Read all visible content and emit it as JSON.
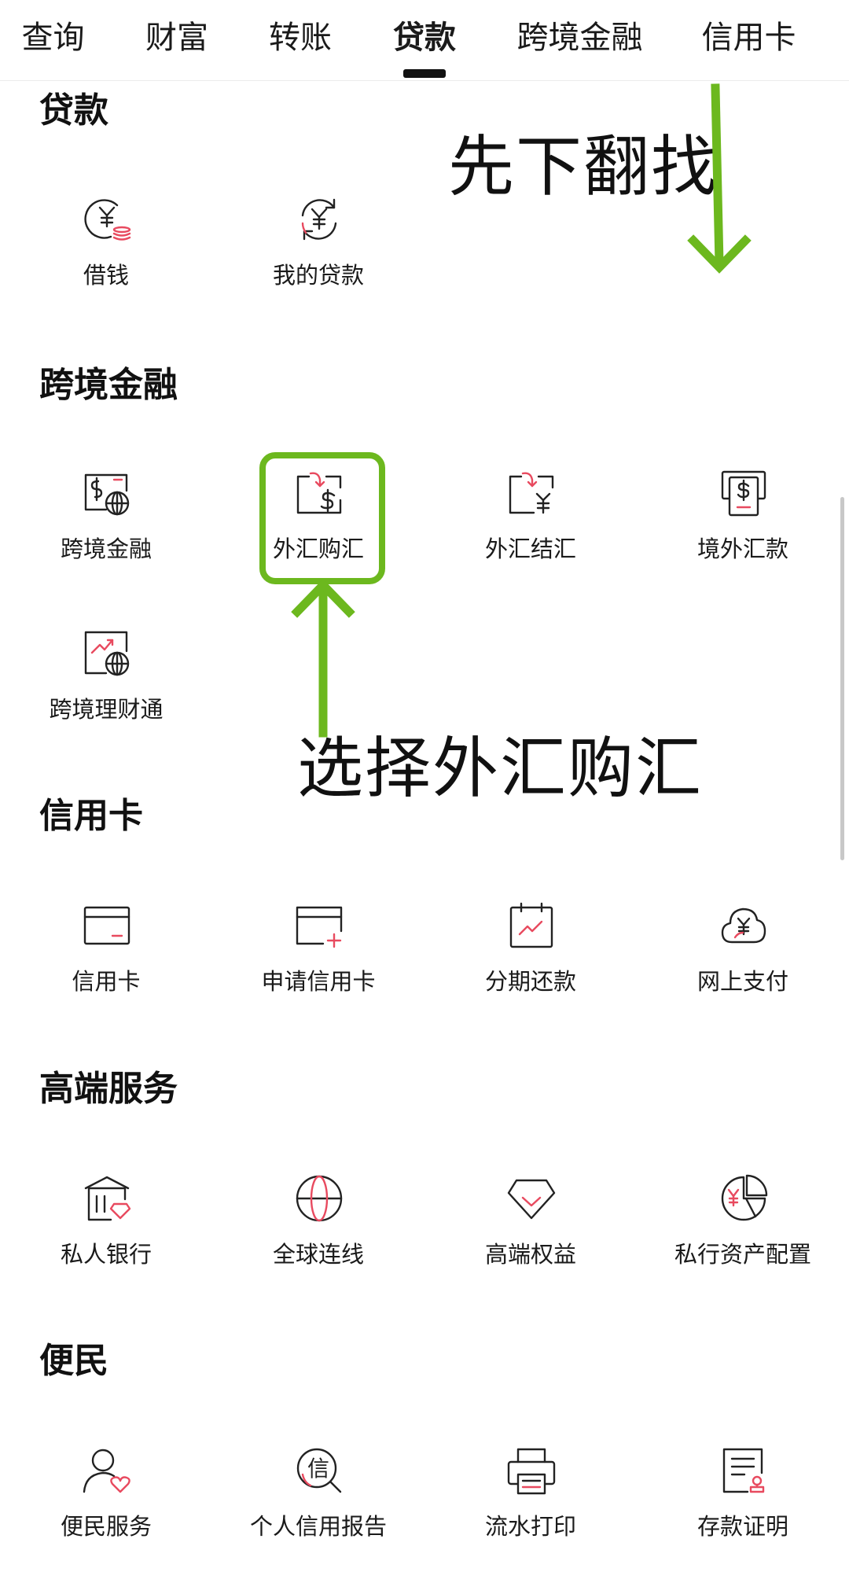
{
  "tabs": [
    {
      "label": "查询",
      "active": false
    },
    {
      "label": "财富",
      "active": false
    },
    {
      "label": "转账",
      "active": false
    },
    {
      "label": "贷款",
      "active": true
    },
    {
      "label": "跨境金融",
      "active": false
    },
    {
      "label": "信用卡",
      "active": false
    }
  ],
  "sections": {
    "loan": {
      "title": "贷款",
      "items": [
        {
          "label": "借钱",
          "icon": "yen-coin-icon"
        },
        {
          "label": "我的贷款",
          "icon": "yen-refresh-icon"
        }
      ]
    },
    "cross_border": {
      "title": "跨境金融",
      "items": [
        {
          "label": "跨境金融",
          "icon": "dollar-globe-icon"
        },
        {
          "label": "外汇购汇",
          "icon": "dollar-exchange-icon"
        },
        {
          "label": "外汇结汇",
          "icon": "yen-exchange-icon"
        },
        {
          "label": "境外汇款",
          "icon": "dollar-remit-icon"
        },
        {
          "label": "跨境理财通",
          "icon": "chart-globe-icon"
        }
      ]
    },
    "credit_card": {
      "title": "信用卡",
      "items": [
        {
          "label": "信用卡",
          "icon": "credit-card-icon"
        },
        {
          "label": "申请信用卡",
          "icon": "card-add-icon"
        },
        {
          "label": "分期还款",
          "icon": "calendar-chart-icon"
        },
        {
          "label": "网上支付",
          "icon": "yen-cloud-icon"
        }
      ]
    },
    "premium": {
      "title": "高端服务",
      "items": [
        {
          "label": "私人银行",
          "icon": "bank-diamond-icon"
        },
        {
          "label": "全球连线",
          "icon": "globe-icon"
        },
        {
          "label": "高端权益",
          "icon": "diamond-icon"
        },
        {
          "label": "私行资产配置",
          "icon": "pie-yen-icon"
        }
      ]
    },
    "convenience": {
      "title": "便民",
      "items": [
        {
          "label": "便民服务",
          "icon": "user-heart-icon"
        },
        {
          "label": "个人信用报告",
          "icon": "credit-search-icon"
        },
        {
          "label": "流水打印",
          "icon": "printer-icon"
        },
        {
          "label": "存款证明",
          "icon": "certificate-icon"
        }
      ]
    }
  },
  "annotations": {
    "scroll_hint": "先下翻找",
    "select_hint": "选择外汇购汇"
  },
  "colors": {
    "accent_red": "#e84a5f",
    "highlight_green": "#6cb81e",
    "icon_stroke": "#222222"
  }
}
